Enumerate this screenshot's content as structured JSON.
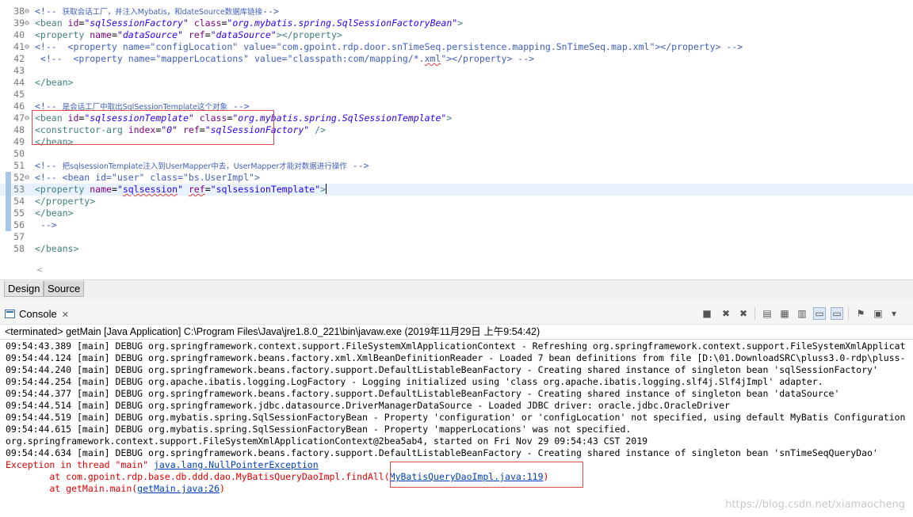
{
  "editor": {
    "lines": [
      {
        "n": "38",
        "fold": true,
        "segs": [
          {
            "t": "<!-- ",
            "c": "cmt"
          },
          {
            "t": "获取会话工厂，并注入Mybatis，和dateSource数据库链接",
            "c": "cmt cjk"
          },
          {
            "t": "-->",
            "c": "cmt"
          }
        ]
      },
      {
        "n": "39",
        "fold": true,
        "segs": [
          {
            "t": "<bean ",
            "c": "tag"
          },
          {
            "t": "id",
            "c": "attr"
          },
          {
            "t": "=",
            "c": ""
          },
          {
            "t": "\"sqlSessionFactory\"",
            "c": "val"
          },
          {
            "t": " class",
            "c": "attr"
          },
          {
            "t": "=",
            "c": ""
          },
          {
            "t": "\"org.mybatis.spring.SqlSessionFactoryBean\"",
            "c": "val"
          },
          {
            "t": ">",
            "c": "tag"
          }
        ]
      },
      {
        "n": "40",
        "fold": false,
        "segs": [
          {
            "t": "<property ",
            "c": "tag"
          },
          {
            "t": "name",
            "c": "attr"
          },
          {
            "t": "=",
            "c": ""
          },
          {
            "t": "\"dataSource\"",
            "c": "val"
          },
          {
            "t": " ref",
            "c": "attr"
          },
          {
            "t": "=",
            "c": ""
          },
          {
            "t": "\"dataSource\"",
            "c": "val"
          },
          {
            "t": "></property>",
            "c": "tag"
          }
        ]
      },
      {
        "n": "41",
        "fold": true,
        "segs": [
          {
            "t": "<!--  <property name=\"configLocation\" value=\"com.gpoint.rdp.door.snTimeSeq.persistence.mapping.SnTimeSeq.map.xml\"></property> -->",
            "c": "cmt"
          }
        ]
      },
      {
        "n": "42",
        "fold": false,
        "segs": [
          {
            "t": " <!--  <property name=\"mapperLocations\" value=\"classpath:com/mapping/*.",
            "c": "cmt"
          },
          {
            "t": "xml",
            "c": "cmt sq"
          },
          {
            "t": "\"></property> -->",
            "c": "cmt"
          }
        ]
      },
      {
        "n": "43",
        "fold": false,
        "segs": []
      },
      {
        "n": "44",
        "fold": false,
        "segs": [
          {
            "t": "</bean>",
            "c": "tag"
          }
        ]
      },
      {
        "n": "45",
        "fold": false,
        "segs": []
      },
      {
        "n": "46",
        "fold": false,
        "segs": [
          {
            "t": "<!-- ",
            "c": "cmt"
          },
          {
            "t": "是会话工厂中取出SqlSessionTemplate这个对象",
            "c": "cmt cjk"
          },
          {
            "t": " -->",
            "c": "cmt"
          }
        ]
      },
      {
        "n": "47",
        "fold": true,
        "segs": [
          {
            "t": "<bean ",
            "c": "tag"
          },
          {
            "t": "id",
            "c": "attr"
          },
          {
            "t": "=",
            "c": ""
          },
          {
            "t": "\"sqlsessionTemplate\"",
            "c": "val"
          },
          {
            "t": " class",
            "c": "attr"
          },
          {
            "t": "=",
            "c": ""
          },
          {
            "t": "\"org.mybatis.spring.SqlSessionTemplate\"",
            "c": "val"
          },
          {
            "t": ">",
            "c": "tag"
          }
        ]
      },
      {
        "n": "48",
        "fold": false,
        "segs": [
          {
            "t": "<constructor-arg ",
            "c": "tag"
          },
          {
            "t": "index",
            "c": "attr"
          },
          {
            "t": "=",
            "c": ""
          },
          {
            "t": "\"0\"",
            "c": "val"
          },
          {
            "t": " ref",
            "c": "attr"
          },
          {
            "t": "=",
            "c": ""
          },
          {
            "t": "\"sqlSessionFactory\"",
            "c": "val"
          },
          {
            "t": " />",
            "c": "tag"
          }
        ]
      },
      {
        "n": "49",
        "fold": false,
        "segs": [
          {
            "t": "</bean>",
            "c": "tag"
          }
        ]
      },
      {
        "n": "50",
        "fold": false,
        "segs": []
      },
      {
        "n": "51",
        "fold": false,
        "segs": [
          {
            "t": "<!-- ",
            "c": "cmt"
          },
          {
            "t": "把sqlsessionTemplate注入到UserMapper中去，UserMapper才能对数据进行操作",
            "c": "cmt cjk"
          },
          {
            "t": " -->",
            "c": "cmt"
          }
        ]
      },
      {
        "n": "52",
        "fold": true,
        "segs": [
          {
            "t": "<!-- <bean id=\"user\" class=\"bs.UserImpl\">",
            "c": "cmt"
          }
        ]
      },
      {
        "n": "53",
        "fold": false,
        "current": true,
        "segs": [
          {
            "t": "<property ",
            "c": "tag"
          },
          {
            "t": "name",
            "c": "attr"
          },
          {
            "t": "=",
            "c": ""
          },
          {
            "t": "\"",
            "c": "valn"
          },
          {
            "t": "sqlsession",
            "c": "valn sq"
          },
          {
            "t": "\"",
            "c": "valn"
          },
          {
            "t": " ",
            "c": ""
          },
          {
            "t": "ref",
            "c": "attr sq"
          },
          {
            "t": "=",
            "c": ""
          },
          {
            "t": "\"sqlsessionTemplate\"",
            "c": "valn"
          },
          {
            "t": ">",
            "c": "tag"
          }
        ]
      },
      {
        "n": "54",
        "fold": false,
        "segs": [
          {
            "t": "</property>",
            "c": "tag"
          }
        ]
      },
      {
        "n": "55",
        "fold": false,
        "segs": [
          {
            "t": "</bean>",
            "c": "tag"
          }
        ]
      },
      {
        "n": "56",
        "fold": false,
        "segs": [
          {
            "t": " -->",
            "c": "cmt"
          }
        ]
      },
      {
        "n": "57",
        "fold": false,
        "segs": []
      },
      {
        "n": "58",
        "fold": false,
        "segs": [
          {
            "t": "</beans>",
            "c": "tag"
          }
        ]
      }
    ]
  },
  "tabs": {
    "design": "Design",
    "source": "Source"
  },
  "console": {
    "title": "Console",
    "close_glyph": "✕",
    "terminated": "<terminated> getMain [Java Application] C:\\Program Files\\Java\\jre1.8.0_221\\bin\\javaw.exe (2019年11月29日 上午9:54:42)",
    "lines": [
      {
        "segs": [
          {
            "t": "09:54:43.389 [main] DEBUG org.springframework.context.support.FileSystemXmlApplicationContext - Refreshing org.springframework.context.support.FileSystemXmlApplicat"
          }
        ]
      },
      {
        "segs": [
          {
            "t": "09:54:44.124 [main] DEBUG org.springframework.beans.factory.xml.XmlBeanDefinitionReader - Loaded 7 bean definitions from file [D:\\01.DownloadSRC\\pluss3.0-rdp\\pluss-"
          }
        ]
      },
      {
        "segs": [
          {
            "t": "09:54:44.240 [main] DEBUG org.springframework.beans.factory.support.DefaultListableBeanFactory - Creating shared instance of singleton bean 'sqlSessionFactory'"
          }
        ]
      },
      {
        "segs": [
          {
            "t": "09:54:44.254 [main] DEBUG org.apache.ibatis.logging.LogFactory - Logging initialized using 'class org.apache.ibatis.logging.slf4j.Slf4jImpl' adapter."
          }
        ]
      },
      {
        "segs": [
          {
            "t": "09:54:44.377 [main] DEBUG org.springframework.beans.factory.support.DefaultListableBeanFactory - Creating shared instance of singleton bean 'dataSource'"
          }
        ]
      },
      {
        "segs": [
          {
            "t": "09:54:44.514 [main] DEBUG org.springframework.jdbc.datasource.DriverManagerDataSource - Loaded JDBC driver: oracle.jdbc.OracleDriver"
          }
        ]
      },
      {
        "segs": [
          {
            "t": "09:54:44.519 [main] DEBUG org.mybatis.spring.SqlSessionFactoryBean - Property 'configuration' or 'configLocation' not specified, using default MyBatis Configuration"
          }
        ]
      },
      {
        "segs": [
          {
            "t": "09:54:44.615 [main] DEBUG org.mybatis.spring.SqlSessionFactoryBean - Property 'mapperLocations' was not specified."
          }
        ]
      },
      {
        "segs": [
          {
            "t": "org.springframework.context.support.FileSystemXmlApplicationContext@2bea5ab4, started on Fri Nov 29 09:54:43 CST 2019"
          }
        ]
      },
      {
        "segs": [
          {
            "t": "09:54:44.634 [main] DEBUG org.springframework.beans.factory.support.DefaultListableBeanFactory - Creating shared instance of singleton bean 'snTimeSeqQueryDao'"
          }
        ]
      },
      {
        "err": true,
        "segs": [
          {
            "t": "Exception in thread \"main\" "
          },
          {
            "t": "java.lang.NullPointerException",
            "link": true
          }
        ]
      },
      {
        "err": true,
        "segs": [
          {
            "t": "\tat com.gpoint.rdp.base.db.ddd.dao.MyBatisQueryDaoImpl.findAll("
          },
          {
            "t": "MyBatisQueryDaoImpl.java:119",
            "link": true
          },
          {
            "t": ")"
          }
        ]
      },
      {
        "err": true,
        "segs": [
          {
            "t": "\tat getMain.main("
          },
          {
            "t": "getMain.java:26",
            "link": true
          },
          {
            "t": ")"
          }
        ]
      }
    ]
  },
  "toolbar_icons": [
    "terminate-icon",
    "remove-launch-icon",
    "remove-all-terminated-icon",
    "clear-console-icon",
    "scroll-lock-icon",
    "word-wrap-icon",
    "show-on-stdout-icon",
    "show-on-stderr-icon",
    "pin-console-icon",
    "display-console-icon",
    "view-menu-icon"
  ],
  "watermark": "https://blog.csdn.net/xiamaocheng"
}
